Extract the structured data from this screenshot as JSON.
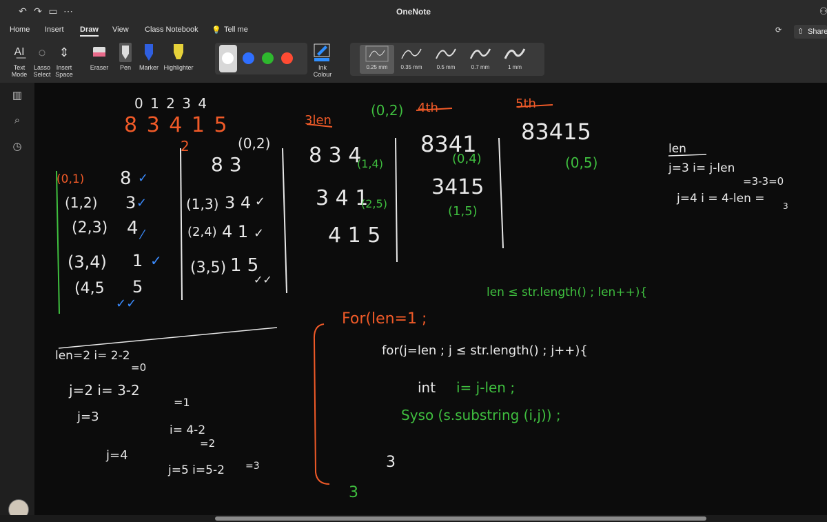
{
  "app": {
    "title": "OneNote"
  },
  "menu": [
    {
      "label": "Home"
    },
    {
      "label": "Insert"
    },
    {
      "label": "Draw"
    },
    {
      "label": "View"
    },
    {
      "label": "Class Notebook"
    },
    {
      "label": "Tell me"
    }
  ],
  "share_label": "Share",
  "ribbon": {
    "text_mode": "Text Mode",
    "lasso_select": "Lasso Select",
    "insert_space": "Insert Space",
    "eraser": "Eraser",
    "pen": "Pen",
    "marker": "Marker",
    "highlighter": "Highlighter",
    "ink_colour": "Ink Colour",
    "colors": [
      "#ffffff",
      "#2f6fff",
      "#2eb82e",
      "#ff4b33"
    ],
    "thickness": [
      "0.25 mm",
      "0.35 mm",
      "0.5 mm",
      "0.7 mm",
      "1 mm"
    ]
  },
  "ink": {
    "idx": "0 1 2 3 4",
    "num": "8 3 4 1 5",
    "two": "2",
    "len3": "3len",
    "len4": "4th",
    "len5": "5th",
    "p02": "(0,2)",
    "p02b": "(0,2)",
    "r1a": "(0,1)",
    "r1b": "8",
    "r2a": "(1,2)",
    "r2b": "3",
    "r3a": "(2,3)",
    "r3b": "4",
    "r4a": "(3,4)",
    "r4b": "1",
    "r5a": "(4,5",
    "r5b": "5",
    "c2r1": "8 3",
    "c2r2a": "(1,3)",
    "c2r2b": "3 4",
    "c2r3a": "(2,4)",
    "c2r3b": "4 1",
    "c2r4a": "(3,5)",
    "c2r4b": "1 5",
    "c3r1": "8 3 4",
    "c3r2": "3 4 1",
    "c3r3": "4 1 5",
    "c3g1": "(1,4)",
    "c3g2": "(2,5)",
    "c4r1": "8341",
    "c4r2": "3415",
    "c4g1": "(0,4)",
    "c4g2": "(1,5)",
    "c5r1": "83415",
    "c5g1": "(0,5)",
    "right1": "len",
    "right2": "j=3   i= j-len",
    "right3": "=3-3=0",
    "right4": "j=4   i = 4-len =",
    "right5": "3",
    "ll1": "len=2   i= 2-2",
    "ll2": "=0",
    "ll3": "j=2        i= 3-2",
    "ll4": "=1",
    "ll5": "j=3",
    "ll6": "i= 4-2",
    "ll7": "=2",
    "ll8": "j=4",
    "ll9": "j=5   i=5-2",
    "ll10": "=3",
    "code1a": "For(len=1 ;",
    "code1b": "len ≤ str.length() ; len++){",
    "code2": "for(j=len ;   j ≤ str.length() ;   j++){",
    "code3a": "int ",
    "code3b": "i= j-len ;",
    "code4": "Syso (s.substring (i,j)) ;",
    "code5": "3",
    "code6": "3"
  }
}
